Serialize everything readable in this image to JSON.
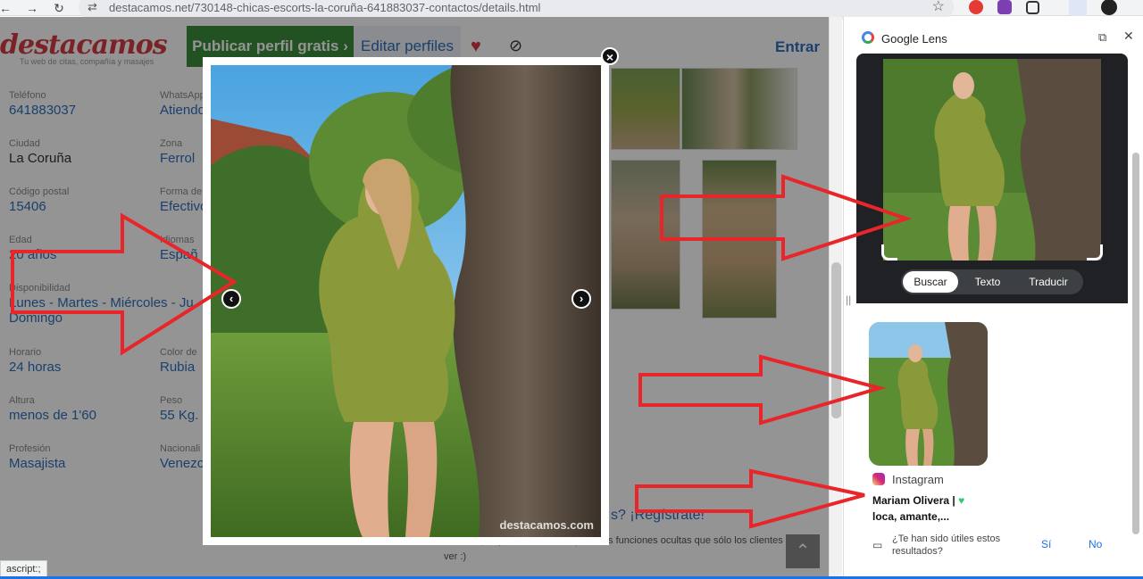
{
  "browser": {
    "url": "destacamos.net/730148-chicas-escorts-la-coruña-641883037-contactos/details.html",
    "nav_back": "←",
    "nav_forward": "→",
    "nav_reload": "↻",
    "url_icon": "⇄",
    "bookmark": "☆"
  },
  "site": {
    "logo": "destacamos",
    "tagline": "Tu web de citas, compañía y masajes",
    "publish_label": "Publicar perfil gratis ›",
    "edit_label": "Editar perfiles",
    "heart_icon": "♥",
    "eye_icon": "⊘",
    "login_label": "Entrar"
  },
  "profile": {
    "left": [
      {
        "label": "Teléfono",
        "value": "641883037"
      },
      {
        "label": "Ciudad",
        "value": "La Coruña"
      },
      {
        "label": "Código postal",
        "value": "15406"
      },
      {
        "label": "Edad",
        "value": "20 años"
      },
      {
        "label": "Disponibilidad",
        "value": "Lunes - Martes - Miércoles - Ju"
      },
      {
        "label": "",
        "value": "Domingo"
      },
      {
        "label": "Horario",
        "value": "24 horas"
      },
      {
        "label": "Altura",
        "value": "menos de 1'60"
      },
      {
        "label": "Profesión",
        "value": "Masajista"
      }
    ],
    "right": [
      {
        "label": "WhatsApp",
        "value": "Atiendo"
      },
      {
        "label": "Zona",
        "value": "Ferrol"
      },
      {
        "label": "Forma de",
        "value": "Efectivo"
      },
      {
        "label": "Idiomas",
        "value": "Españ"
      },
      {
        "label": "Color de",
        "value": "Rubia"
      },
      {
        "label": "Peso",
        "value": "55 Kg."
      },
      {
        "label": "Nacionali",
        "value": "Venezo"
      }
    ]
  },
  "register_text": "s? ¡Regístrate!",
  "promo_text": "ara siempre y en todos tus dispositivos funciones ocultas que sólo los clientes pueden ver :)",
  "scroll_top": "⌃",
  "status_text": "ascript:;",
  "lightbox": {
    "close": "×",
    "prev": "‹",
    "next": "›",
    "watermark": "destacamos.com"
  },
  "lens": {
    "title": "Google Lens",
    "open_icon": "⧉",
    "close_icon": "✕",
    "tabs": [
      "Buscar",
      "Texto",
      "Traducir"
    ],
    "active_tab": "Buscar",
    "result_source": "Instagram",
    "result_title": "Mariam Olivera |",
    "result_title_2": "loca, amante,...",
    "result_heart": "♥",
    "feedback_question": "¿Te han sido útiles estos resultados?",
    "feedback_yes": "Sí",
    "feedback_no": "No",
    "feedback_icon": "▭",
    "handle": "||"
  },
  "colors": {
    "brand_red": "#d23c43",
    "publish_green": "#3c8d3c",
    "link_blue": "#2f6fba",
    "arrow_red": "#e8262a",
    "dress_green": "#8a9a3a"
  }
}
